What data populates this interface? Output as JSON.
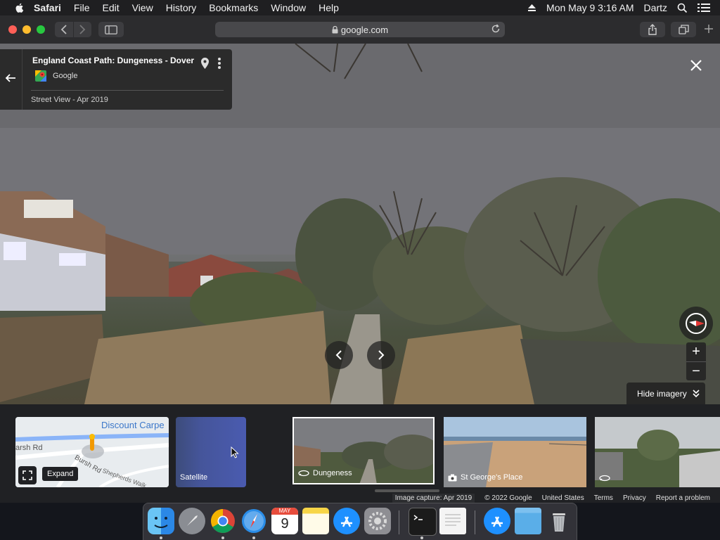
{
  "menubar": {
    "app_name": "Safari",
    "items": [
      "File",
      "Edit",
      "View",
      "History",
      "Bookmarks",
      "Window",
      "Help"
    ],
    "clock": "Mon May 9  3:16 AM",
    "user": "Dartz"
  },
  "toolbar": {
    "url": "google.com"
  },
  "street_view": {
    "title": "England Coast Path: Dungeness - Dover",
    "provider": "Google",
    "capture_label": "Street View - Apr 2019",
    "hide_imagery": "Hide imagery"
  },
  "strip": {
    "map": {
      "poi": "Discount Carpe",
      "road1": "arsh Rd",
      "road2": "Bursh Rd",
      "road3": "Shepherds Walk",
      "expand": "Expand"
    },
    "satellite": "Satellite",
    "thumbs": [
      "Dungeness",
      "St George's Place"
    ]
  },
  "footer": {
    "capture": "Image capture: Apr 2019",
    "copyright": "© 2022 Google",
    "region": "United States",
    "terms": "Terms",
    "privacy": "Privacy",
    "report": "Report a problem"
  },
  "dock": {
    "apps": [
      "finder-icon",
      "launchpad-icon",
      "chrome-icon",
      "safari-icon",
      "calendar-icon",
      "notes-icon",
      "app-store-icon",
      "system-preferences-icon",
      "terminal-icon",
      "textedit-icon",
      "app-store-folder-icon",
      "downloads-folder-icon",
      "trash-icon"
    ],
    "calendar_month": "MAY",
    "calendar_day": "9"
  },
  "colors": {
    "menubar": "#1f1f21",
    "toolbar": "#2c2c2e",
    "close_red": "#fe5f57",
    "minimize_yellow": "#febc2e",
    "zoom_green": "#28c840",
    "map_poi_blue": "#3b77c9"
  }
}
